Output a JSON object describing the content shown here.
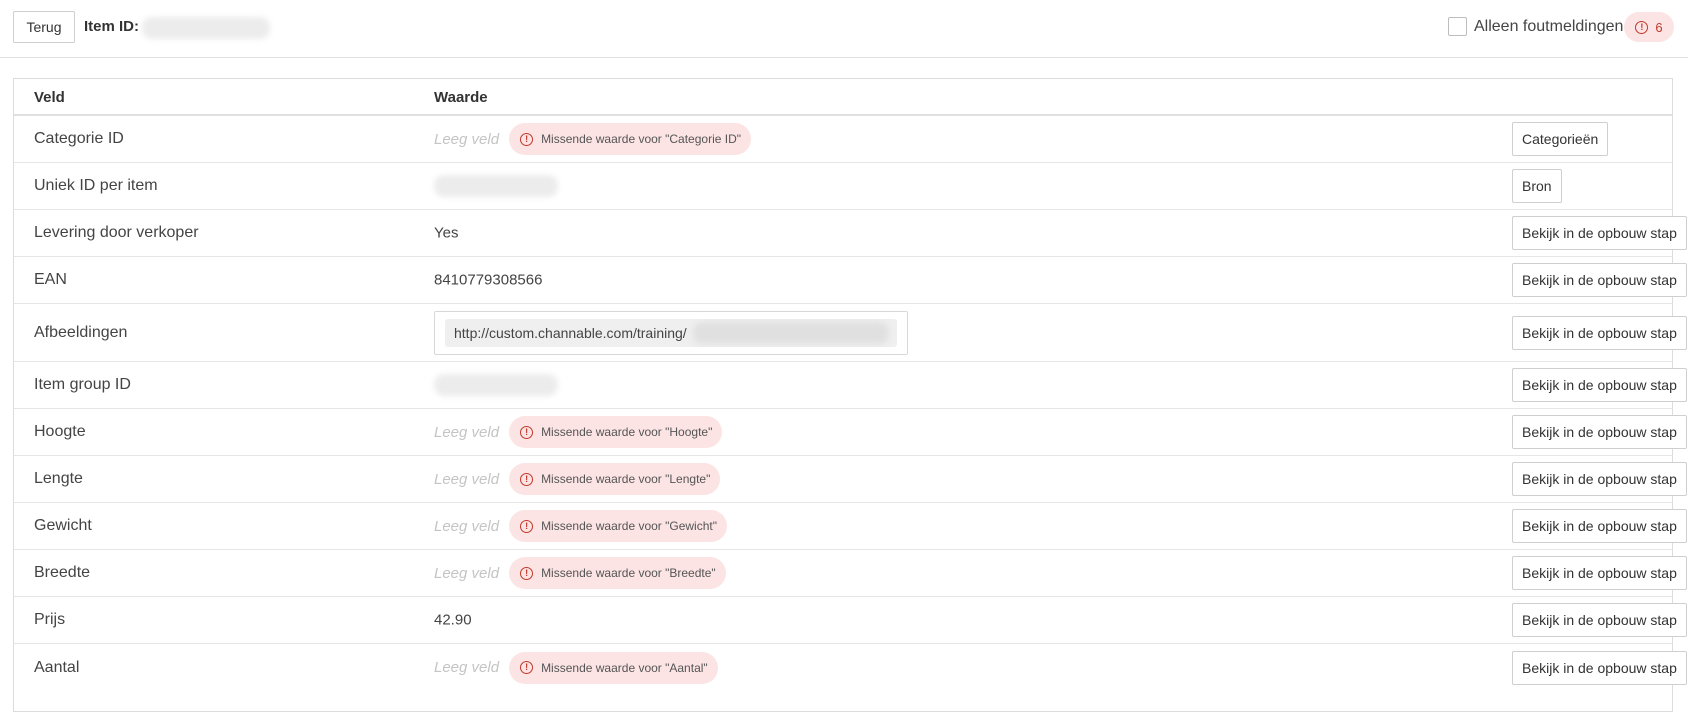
{
  "header": {
    "back_label": "Terug",
    "item_id_label": "Item ID:",
    "only_errors_label": "Alleen foutmeldingen",
    "error_count": "6"
  },
  "table": {
    "columns": {
      "field": "Veld",
      "value": "Waarde"
    },
    "empty_label": "Leeg veld",
    "rows": [
      {
        "field": "Categorie ID",
        "value": null,
        "error": "Missende waarde voor \"Categorie ID\"",
        "action": "Categorieën"
      },
      {
        "field": "Uniek ID per item",
        "value": null,
        "blurred": true,
        "action": "Bron"
      },
      {
        "field": "Levering door verkoper",
        "value": "Yes",
        "action": "Bekijk in de opbouw stap"
      },
      {
        "field": "EAN",
        "value": "8410779308566",
        "action": "Bekijk in de opbouw stap"
      },
      {
        "field": "Afbeeldingen",
        "url": "http://custom.channable.com/training/",
        "action": "Bekijk in de opbouw stap"
      },
      {
        "field": "Item group ID",
        "value": null,
        "blurred": true,
        "action": "Bekijk in de opbouw stap"
      },
      {
        "field": "Hoogte",
        "value": null,
        "error": "Missende waarde voor \"Hoogte\"",
        "action": "Bekijk in de opbouw stap"
      },
      {
        "field": "Lengte",
        "value": null,
        "error": "Missende waarde voor \"Lengte\"",
        "action": "Bekijk in de opbouw stap"
      },
      {
        "field": "Gewicht",
        "value": null,
        "error": "Missende waarde voor \"Gewicht\"",
        "action": "Bekijk in de opbouw stap"
      },
      {
        "field": "Breedte",
        "value": null,
        "error": "Missende waarde voor \"Breedte\"",
        "action": "Bekijk in de opbouw stap"
      },
      {
        "field": "Prijs",
        "value": "42.90",
        "action": "Bekijk in de opbouw stap"
      },
      {
        "field": "Aantal",
        "value": null,
        "error": "Missende waarde voor \"Aantal\"",
        "action": "Bekijk in de opbouw stap"
      }
    ]
  }
}
